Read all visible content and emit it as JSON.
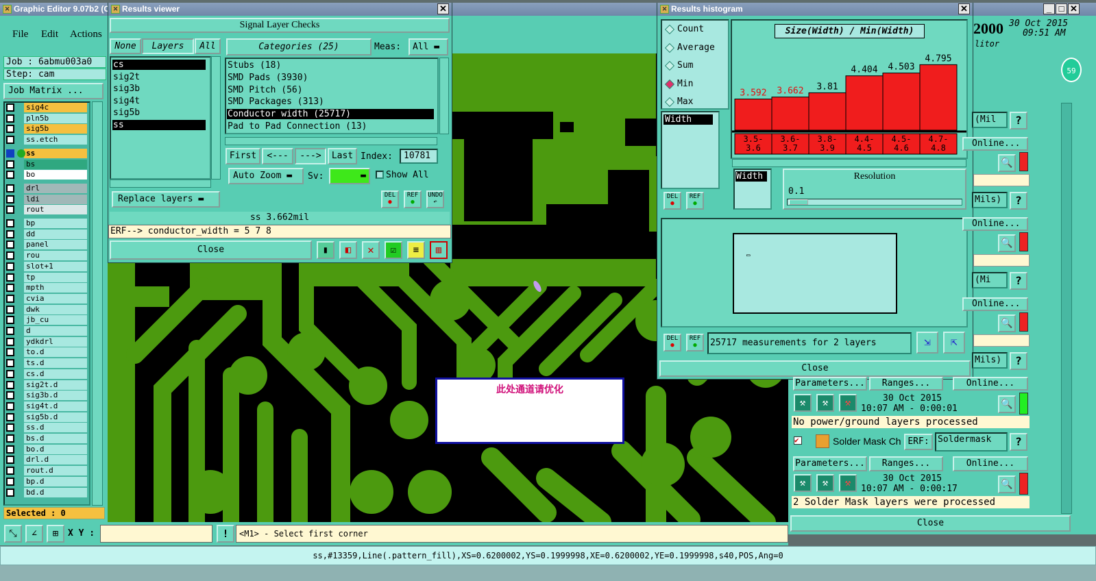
{
  "main": {
    "title": "Graphic Editor 9.07b2 (C",
    "menu": [
      "File",
      "Edit",
      "Actions"
    ],
    "job": "Job : 6abmu003a0",
    "step": "Step: cam",
    "job_matrix": "Job Matrix ...",
    "layers": [
      "sig4c",
      "pln5b",
      "sig5b",
      "ss.etch",
      "ss",
      "bs",
      "bo",
      "drl",
      "ldi",
      "rout",
      "bp",
      "dd",
      "panel",
      "rou",
      "slot+1",
      "tp",
      "mpth",
      "cvia",
      "dwk",
      "jb_cu",
      "d",
      "ydkdrl",
      "to.d",
      "ts.d",
      "cs.d",
      "sig2t.d",
      "sig3b.d",
      "sig4t.d",
      "sig5b.d",
      "ss.d",
      "bs.d",
      "bo.d",
      "drl.d",
      "rout.d",
      "bp.d",
      "bd.d"
    ],
    "selected": "Selected : 0",
    "xy_label": "X Y :",
    "prompt": "<M1> - Select first corner",
    "status": "ss,#13359,Line(.pattern_fill),XS=0.6200002,YS=0.1999998,XE=0.6200002,YE=0.1999998,s40,POS,Ang=0",
    "date_right": "30 Oct 2015",
    "time_right": "09:51 AM",
    "brand_right": "2000",
    "ditor": "litor",
    "badge": "59",
    "annotation": "此处通道请优化"
  },
  "results_viewer": {
    "title": "Results viewer",
    "heading": "Signal Layer Checks",
    "tab_none": "None",
    "tab_layers": "Layers",
    "tab_all": "All",
    "layer_list": [
      "cs",
      "sig2t",
      "sig3b",
      "sig4t",
      "sig5b",
      "ss"
    ],
    "categories_label": "Categories (25)",
    "meas_label": "Meas:",
    "meas_value": "All",
    "categories": [
      "Stubs (18)",
      "SMD Pads (3930)",
      "SMD Pitch (56)",
      "SMD Packages (313)",
      "Conductor width (25717)",
      "Pad to Pad Connection (13)"
    ],
    "first": "First",
    "prev": "<---",
    "next": "--->",
    "last": "Last",
    "index_label": "Index:",
    "index_value": "10781",
    "auto_zoom": "Auto Zoom",
    "sv_label": "Sv:",
    "show_all": "Show All",
    "replace_layers": "Replace layers",
    "del": "DEL",
    "ref": "REF",
    "undo": "UNDO",
    "measurement": "ss 3.662mil",
    "erf": "ERF--> conductor_width = 5 7 8",
    "close": "Close"
  },
  "histogram": {
    "title": "Results histogram",
    "options": [
      "Count",
      "Average",
      "Sum",
      "Min",
      "Max"
    ],
    "selected_option": "Min",
    "chart_title": "Size(Width) / Min(Width)",
    "width_item": "Width",
    "width_item2": "Width",
    "resolution_label": "Resolution",
    "resolution_value": "0.1",
    "summary": "25717 measurements for 2 layers",
    "del": "DEL",
    "ref": "REF",
    "close": "Close",
    "bar_colors": {
      "low": "#e01010",
      "normal": "#000000",
      "fill": "#f01d1d"
    }
  },
  "chart_data": {
    "type": "bar",
    "title": "Size(Width) / Min(Width)",
    "categories": [
      "3.5-\n3.6",
      "3.6-\n3.7",
      "3.8-\n3.9",
      "4.4-\n4.5",
      "4.5-\n4.6",
      "4.7-\n4.8"
    ],
    "category_labels": [
      "3.5-3.6",
      "3.6-3.7",
      "3.8-3.9",
      "4.4-4.5",
      "4.5-4.6",
      "4.7-4.8"
    ],
    "values": [
      3.592,
      3.662,
      3.81,
      4.404,
      4.503,
      4.795
    ],
    "value_labels": [
      "3.592",
      "3.662",
      "3.81",
      "4.404",
      "4.503",
      "4.795"
    ],
    "red_values": [
      true,
      true,
      false,
      false,
      false,
      false
    ],
    "ylim": [
      2.5,
      4.9
    ]
  },
  "right_panel": {
    "rows": [
      {
        "label": "(Mil",
        "has_q": true
      },
      {
        "label": "Online..."
      },
      {
        "label": "Mils)"
      },
      {
        "label": "Online..."
      },
      {
        "label": "(Mi"
      },
      {
        "label": "Online..."
      },
      {
        "label": "Mils)"
      }
    ],
    "parameters": "Parameters...",
    "ranges": "Ranges...",
    "online": "Online...",
    "date1": "30 Oct 2015",
    "time1": "10:07 AM - 0:00:01",
    "msg1": "No power/ground layers processed",
    "solder_label": "Solder Mask Ch",
    "erf_label": "ERF:",
    "erf_value": "Soldermask",
    "date2": "30 Oct 2015",
    "time2": "10:07 AM - 0:00:17",
    "msg2": "2 Solder Mask layers were processed",
    "close": "Close",
    "q": "?"
  }
}
